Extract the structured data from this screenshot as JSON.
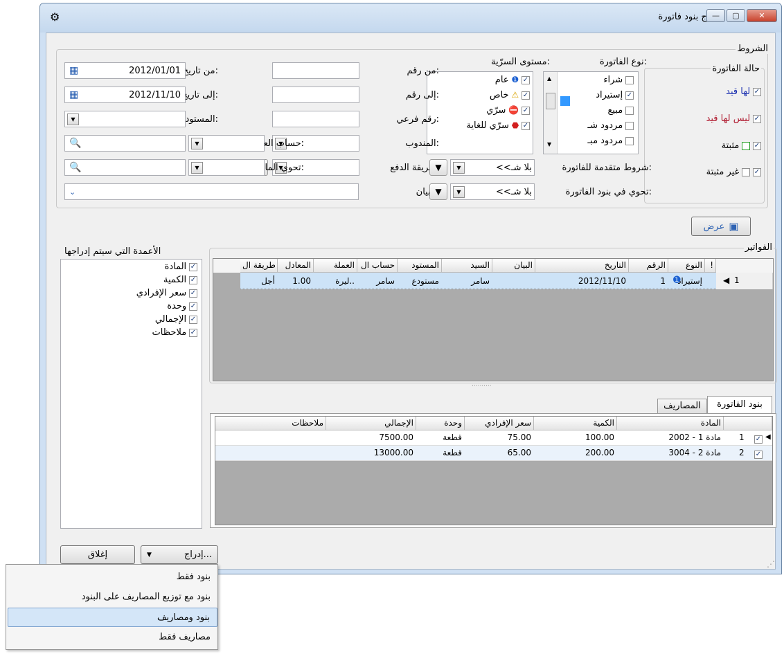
{
  "window": {
    "title": "إدراج بنود فاتورة",
    "close_glyph": "✕",
    "max_glyph": "▢",
    "min_glyph": "—"
  },
  "conditions": {
    "group_label": "الشروط",
    "invoice_state": {
      "label": "حالة الفاتورة",
      "items": [
        {
          "label": "لها قيد",
          "checked": true,
          "color": "#1a2fb0"
        },
        {
          "label": "ليس لها قيد",
          "checked": true,
          "color": "#b01a2f"
        },
        {
          "label": "مثبتة",
          "checked": true,
          "color": "#000000"
        },
        {
          "label": "غير مثبتة",
          "checked": true,
          "color": "#000000"
        }
      ]
    },
    "invoice_type": {
      "label": "نوع الفاتورة:",
      "items": [
        {
          "label": "شراء",
          "checked": false
        },
        {
          "label": "إستيراد",
          "checked": true
        },
        {
          "label": "مبيع",
          "checked": false
        },
        {
          "label": "مردود شـ",
          "checked": false
        },
        {
          "label": "مردود مبـ",
          "checked": false
        }
      ]
    },
    "security_level": {
      "label": "مستوى السرّية:",
      "items": [
        {
          "label": "عام",
          "checked": true,
          "icon": "info-icon"
        },
        {
          "label": "خاص",
          "checked": true,
          "icon": "warning-icon"
        },
        {
          "label": "سرّي",
          "checked": true,
          "icon": "no-entry-icon"
        },
        {
          "label": "سرّي للغاية",
          "checked": true,
          "icon": "stop-icon"
        }
      ]
    },
    "from_number_label": "من رقم:",
    "to_number_label": "إلى رقم:",
    "sub_number_label": "رقم فرعي:",
    "delegate_label": "المندوب:",
    "payment_method_label": "طريقة الدفع:",
    "statement_label": "البيان:",
    "from_date_label": "من تاريخ:",
    "from_date": "2012/01/01",
    "to_date_label": "إلى تاريخ:",
    "to_date": "2012/11/10",
    "warehouse_label": "المستودع:",
    "customer_account_label": "حساب العميل:",
    "contains_material_label": "تحوي المادة:",
    "advanced_conditions_label": "شروط متقدمة للفاتورة:",
    "advanced_conditions_value": "<<بلا شـ",
    "contains_items_label": "تحوي في بنود الفاتورة:",
    "contains_items_value": "<<بلا شـ"
  },
  "show_button": "عرض",
  "invoices": {
    "group_label": "الفواتير",
    "columns": [
      "!",
      "النوع",
      "الرقم",
      "التاريخ",
      "البيان",
      "السيد",
      "المستود",
      "حساب ال",
      "العملة",
      "المعادل",
      "طريقة ال"
    ],
    "rows": [
      {
        "index": "1",
        "type": "إستيراد",
        "number": "1",
        "date": "2012/11/10",
        "statement": "",
        "mr": "سامر",
        "warehouse": "مستودع",
        "account": "سامر",
        "currency": "ليرة..",
        "equivalent": "1.00",
        "payment": "أجل"
      }
    ]
  },
  "columns_panel": {
    "label": "الأعمدة التي سيتم إدراجها",
    "items": [
      {
        "label": "المادة",
        "checked": true
      },
      {
        "label": "الكمية",
        "checked": true
      },
      {
        "label": "سعر الإفرادي",
        "checked": true
      },
      {
        "label": "وحدة",
        "checked": true
      },
      {
        "label": "الإجمالي",
        "checked": true
      },
      {
        "label": "ملاحظات",
        "checked": true
      }
    ]
  },
  "tabs": [
    {
      "label": "بنود الفاتورة",
      "active": true
    },
    {
      "label": "المصاريف",
      "active": false
    }
  ],
  "items_grid": {
    "columns": [
      "المادة",
      "الكمية",
      "سعر الإفرادي",
      "وحدة",
      "الإجمالي",
      "ملاحظات"
    ],
    "rows": [
      {
        "index": "1",
        "material": "2002 - مادة 1",
        "quantity": "100.00",
        "unit_price": "75.00",
        "unit": "قطعة",
        "total": "7500.00",
        "notes": ""
      },
      {
        "index": "2",
        "material": "3004 - مادة 2",
        "quantity": "200.00",
        "unit_price": "65.00",
        "unit": "قطعة",
        "total": "13000.00",
        "notes": ""
      }
    ]
  },
  "footer": {
    "insert_button": "إدراج...",
    "close_button": "إغلاق"
  },
  "menu": {
    "items": [
      {
        "label": "بنود فقط",
        "highlighted": false
      },
      {
        "label": "بنود مع توزيع المصاريف على البنود",
        "highlighted": false
      },
      {
        "label": "بنود ومصاريف",
        "highlighted": true
      },
      {
        "label": "مصاريف فقط",
        "highlighted": false
      }
    ]
  },
  "colors": {
    "accent": "#3399ff",
    "selection": "#cde3f7",
    "grid_bg": "#ababab"
  }
}
